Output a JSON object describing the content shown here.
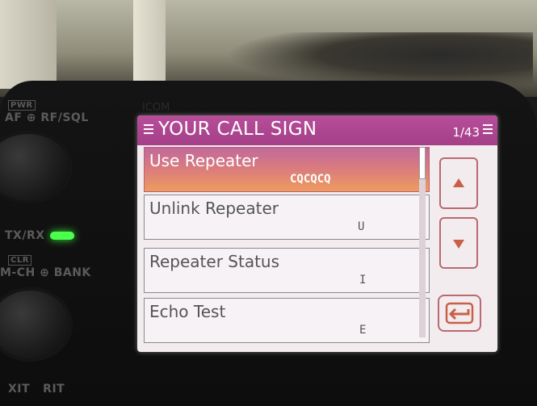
{
  "panel": {
    "pwr_label": "PWR",
    "af_rf_label": "AF ⊕ RF/SQL",
    "txrx_label": "TX/RX",
    "clr_label": "CLR",
    "mch_bank_label": "M-CH ⊕ BANK",
    "xit_rit_label": "XIT   RIT",
    "brand": "ICOM"
  },
  "screen": {
    "title": "YOUR CALL SIGN",
    "page_indicator": "1/43"
  },
  "list": {
    "items": [
      {
        "name": "Use Repeater",
        "code": "CQCQCQ",
        "selected": true
      },
      {
        "name": "Unlink Repeater",
        "code": "U",
        "selected": false
      },
      {
        "name": "Repeater Status",
        "code": "I",
        "selected": false
      },
      {
        "name": "Echo Test",
        "code": "E",
        "selected": false
      }
    ]
  },
  "icons": {
    "menu": "menu-lines-icon",
    "scroll_up": "triangle-up-icon",
    "scroll_down": "triangle-down-icon",
    "back": "return-arrow-icon"
  },
  "colors": {
    "title_bar": "#b74e9a",
    "selected_row_top": "#c06a9a",
    "selected_row_bottom": "#ee9b5f",
    "button_border": "#b86a72",
    "arrow": "#c86048",
    "tx_led": "#4dff4d"
  }
}
